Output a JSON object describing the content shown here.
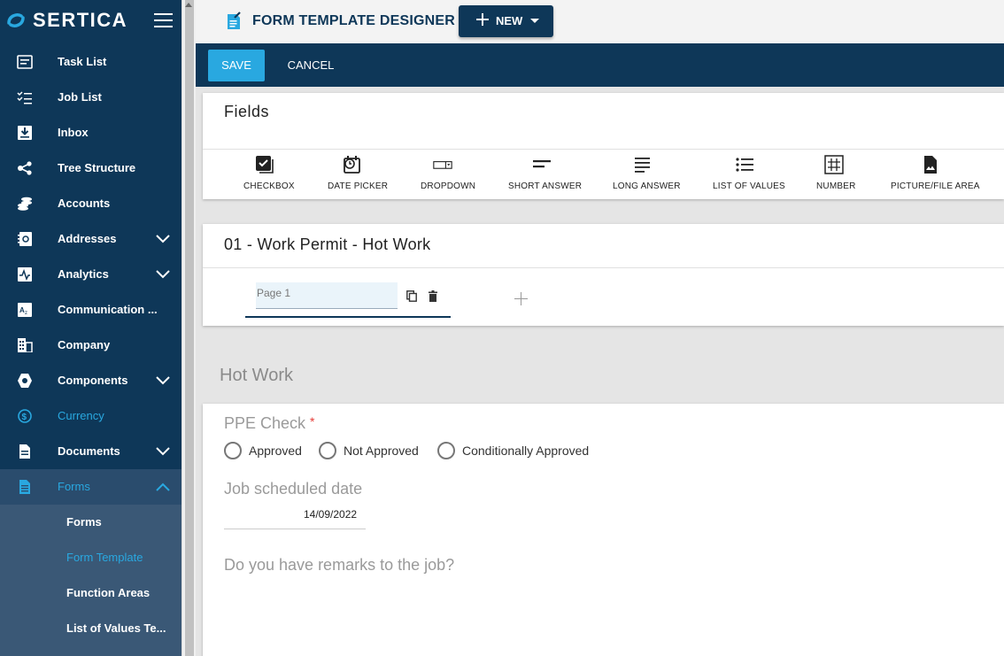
{
  "app": {
    "logo_text": "SERTICA"
  },
  "sidebar": {
    "items": [
      {
        "label": "Task List",
        "icon": "task-list-icon"
      },
      {
        "label": "Job List",
        "icon": "job-list-icon"
      },
      {
        "label": "Inbox",
        "icon": "inbox-icon"
      },
      {
        "label": "Tree Structure",
        "icon": "tree-structure-icon"
      },
      {
        "label": "Accounts",
        "icon": "accounts-icon"
      },
      {
        "label": "Addresses",
        "icon": "addresses-icon",
        "expandable": true
      },
      {
        "label": "Analytics",
        "icon": "analytics-icon",
        "expandable": true
      },
      {
        "label": "Communication ...",
        "icon": "communication-icon"
      },
      {
        "label": "Company",
        "icon": "company-icon"
      },
      {
        "label": "Components",
        "icon": "components-icon",
        "expandable": true
      },
      {
        "label": "Currency",
        "icon": "currency-icon",
        "active": true
      },
      {
        "label": "Documents",
        "icon": "documents-icon",
        "expandable": true
      },
      {
        "label": "Forms",
        "icon": "forms-icon",
        "expanded": true
      }
    ],
    "forms_subitems": [
      {
        "label": "Forms"
      },
      {
        "label": "Form Template",
        "active": true
      },
      {
        "label": "Function Areas"
      },
      {
        "label": "List of Values Te..."
      }
    ]
  },
  "header": {
    "title": "FORM TEMPLATE DESIGNER",
    "new_label": "NEW"
  },
  "actions": {
    "save_label": "SAVE",
    "cancel_label": "CANCEL"
  },
  "fields_panel": {
    "title": "Fields",
    "tools": [
      {
        "label": "CHECKBOX",
        "icon": "checkbox-icon"
      },
      {
        "label": "DATE PICKER",
        "icon": "date-picker-icon"
      },
      {
        "label": "DROPDOWN",
        "icon": "dropdown-icon"
      },
      {
        "label": "SHORT ANSWER",
        "icon": "short-answer-icon"
      },
      {
        "label": "LONG ANSWER",
        "icon": "long-answer-icon"
      },
      {
        "label": "LIST OF VALUES",
        "icon": "list-of-values-icon"
      },
      {
        "label": "NUMBER",
        "icon": "number-icon"
      },
      {
        "label": "PICTURE/FILE AREA",
        "icon": "picture-file-icon"
      }
    ]
  },
  "template": {
    "title": "01 - Work Permit - Hot Work",
    "page_tab_value": "Page 1"
  },
  "form": {
    "section_title": "Hot Work",
    "ppe_label": "PPE Check",
    "required_mark": "*",
    "ppe_options": [
      "Approved",
      "Not Approved",
      "Conditionally Approved"
    ],
    "date_label": "Job scheduled date",
    "date_value": "14/09/2022",
    "remarks_label": "Do you have remarks to the job?"
  },
  "colors": {
    "navy": "#0e3758",
    "accent": "#29a8e0",
    "required": "#e53935"
  }
}
